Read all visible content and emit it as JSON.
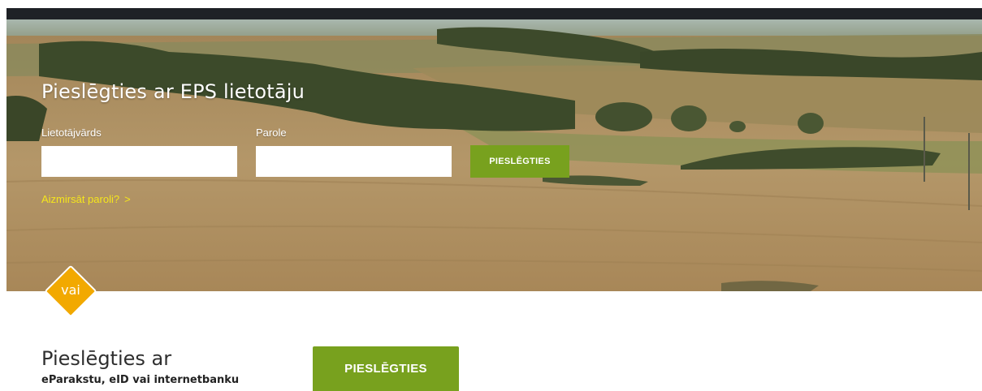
{
  "login": {
    "title": "Pieslēgties ar EPS lietotāju",
    "username_label": "Lietotājvārds",
    "username_value": "",
    "password_label": "Parole",
    "password_value": "",
    "submit_label": "PIESLĒGTIES",
    "forgot_label": "Aizmirsāt paroli?",
    "forgot_icon": "chevron-right-icon",
    "forgot_chevron": ">"
  },
  "separator": {
    "label": "vai"
  },
  "alt_login": {
    "title": "Pieslēgties ar",
    "subtitle": "eParakstu, eID vai internetbanku",
    "button_label": "PIESLĒGTIES"
  },
  "colors": {
    "accent_green": "#78a11e",
    "separator_orange": "#f2a900",
    "forgot_link": "#f5e61c",
    "top_bar": "#1e2126"
  }
}
